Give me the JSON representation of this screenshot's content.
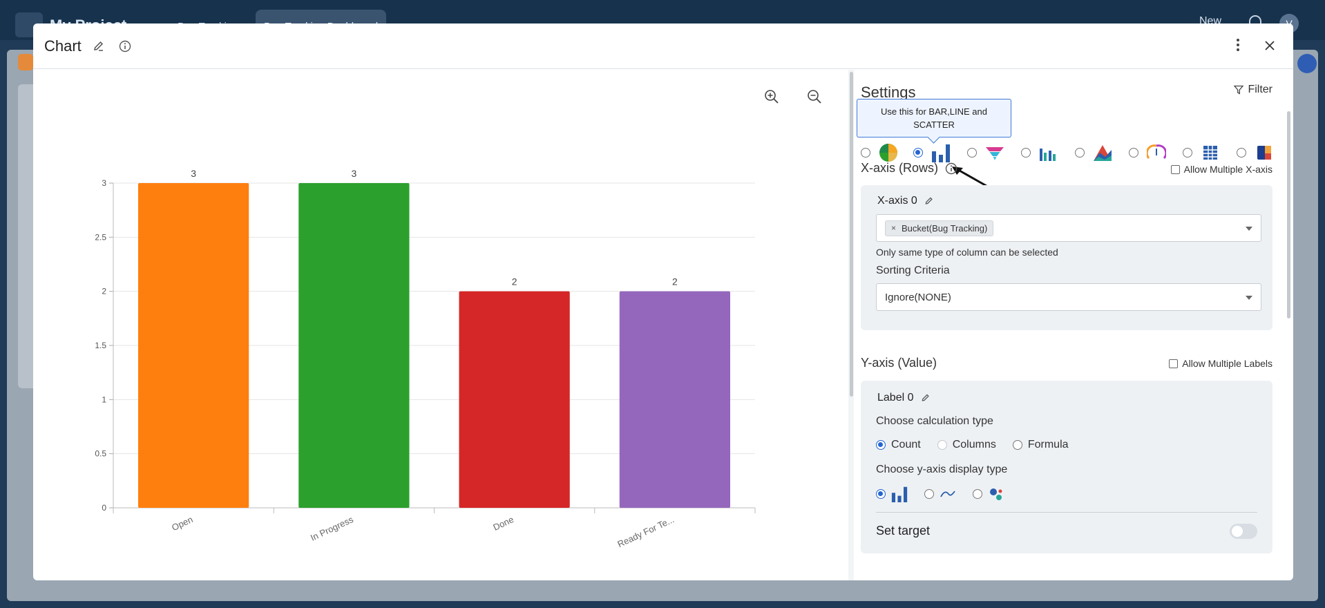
{
  "background": {
    "project": "My Project",
    "tabs": [
      "Bug Tracking",
      "Bug Tracking Dashboard"
    ],
    "new_label": "New",
    "avatar": "V"
  },
  "modal": {
    "title": "Chart",
    "icons": {
      "edit": "pencil-icon",
      "info": "info-icon",
      "menu": "kebab-menu-icon",
      "close": "close-icon"
    }
  },
  "chart_data": {
    "type": "bar",
    "categories": [
      "Open",
      "In Progress",
      "Done",
      "Ready For Te..."
    ],
    "values": [
      3,
      3,
      2,
      2
    ],
    "colors": [
      "#ff7f0e",
      "#2ca02c",
      "#d62728",
      "#9467bd"
    ],
    "data_labels": [
      "3",
      "3",
      "2",
      "2"
    ],
    "ylim": [
      0,
      3
    ],
    "y_ticks": [
      "0",
      "0.5",
      "1",
      "1.5",
      "2",
      "2.5",
      "3"
    ],
    "grid": true
  },
  "settings": {
    "title": "Settings",
    "filter_label": "Filter",
    "tooltip": "Use this for BAR,LINE and SCATTER",
    "chart_types": [
      "pie-chart-icon",
      "bar-chart-icon",
      "funnel-chart-icon",
      "grouped-bar-icon",
      "area-chart-icon",
      "gauge-icon",
      "table-icon",
      "treemap-icon"
    ],
    "selected_chart_type": "bar-chart-icon",
    "x_axis": {
      "title": "X-axis (Rows)",
      "allow_multiple": "Allow Multiple X-axis",
      "label": "X-axis 0",
      "selected_chip": "Bucket(Bug Tracking)",
      "hint": "Only same type of column can be selected",
      "sorting_label": "Sorting Criteria",
      "sorting_value": "Ignore(NONE)"
    },
    "y_axis": {
      "title": "Y-axis (Value)",
      "allow_multiple": "Allow Multiple Labels",
      "label": "Label 0",
      "calc_label": "Choose calculation type",
      "calc_options": [
        "Count",
        "Columns",
        "Formula"
      ],
      "calc_selected": "Count",
      "display_label": "Choose y-axis display type",
      "display_options": [
        "bar-display-icon",
        "line-display-icon",
        "scatter-display-icon"
      ],
      "set_target": "Set target"
    }
  }
}
